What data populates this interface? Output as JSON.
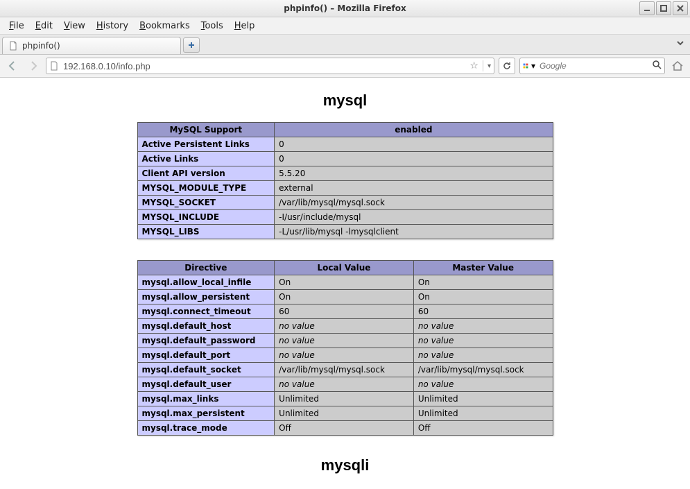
{
  "window": {
    "title": "phpinfo() – Mozilla Firefox"
  },
  "menu": {
    "file": "File",
    "edit": "Edit",
    "view": "View",
    "history": "History",
    "bookmarks": "Bookmarks",
    "tools": "Tools",
    "help": "Help"
  },
  "tab": {
    "title": "phpinfo()"
  },
  "url": {
    "value": "192.168.0.10/info.php"
  },
  "search": {
    "placeholder": "Google"
  },
  "section1": {
    "title": "mysql"
  },
  "section2": {
    "title": "mysqli"
  },
  "table1": {
    "header": [
      "MySQL Support",
      "enabled"
    ],
    "rows": [
      [
        "Active Persistent Links",
        "0"
      ],
      [
        "Active Links",
        "0"
      ],
      [
        "Client API version",
        "5.5.20"
      ],
      [
        "MYSQL_MODULE_TYPE",
        "external"
      ],
      [
        "MYSQL_SOCKET",
        "/var/lib/mysql/mysql.sock"
      ],
      [
        "MYSQL_INCLUDE",
        "-I/usr/include/mysql"
      ],
      [
        "MYSQL_LIBS",
        "-L/usr/lib/mysql -lmysqlclient"
      ]
    ]
  },
  "table2": {
    "header": [
      "Directive",
      "Local Value",
      "Master Value"
    ],
    "rows": [
      {
        "k": "mysql.allow_local_infile",
        "l": "On",
        "m": "On"
      },
      {
        "k": "mysql.allow_persistent",
        "l": "On",
        "m": "On"
      },
      {
        "k": "mysql.connect_timeout",
        "l": "60",
        "m": "60"
      },
      {
        "k": "mysql.default_host",
        "l": "no value",
        "m": "no value",
        "i": true
      },
      {
        "k": "mysql.default_password",
        "l": "no value",
        "m": "no value",
        "i": true
      },
      {
        "k": "mysql.default_port",
        "l": "no value",
        "m": "no value",
        "i": true
      },
      {
        "k": "mysql.default_socket",
        "l": "/var/lib/mysql/mysql.sock",
        "m": "/var/lib/mysql/mysql.sock"
      },
      {
        "k": "mysql.default_user",
        "l": "no value",
        "m": "no value",
        "i": true
      },
      {
        "k": "mysql.max_links",
        "l": "Unlimited",
        "m": "Unlimited"
      },
      {
        "k": "mysql.max_persistent",
        "l": "Unlimited",
        "m": "Unlimited"
      },
      {
        "k": "mysql.trace_mode",
        "l": "Off",
        "m": "Off"
      }
    ]
  }
}
